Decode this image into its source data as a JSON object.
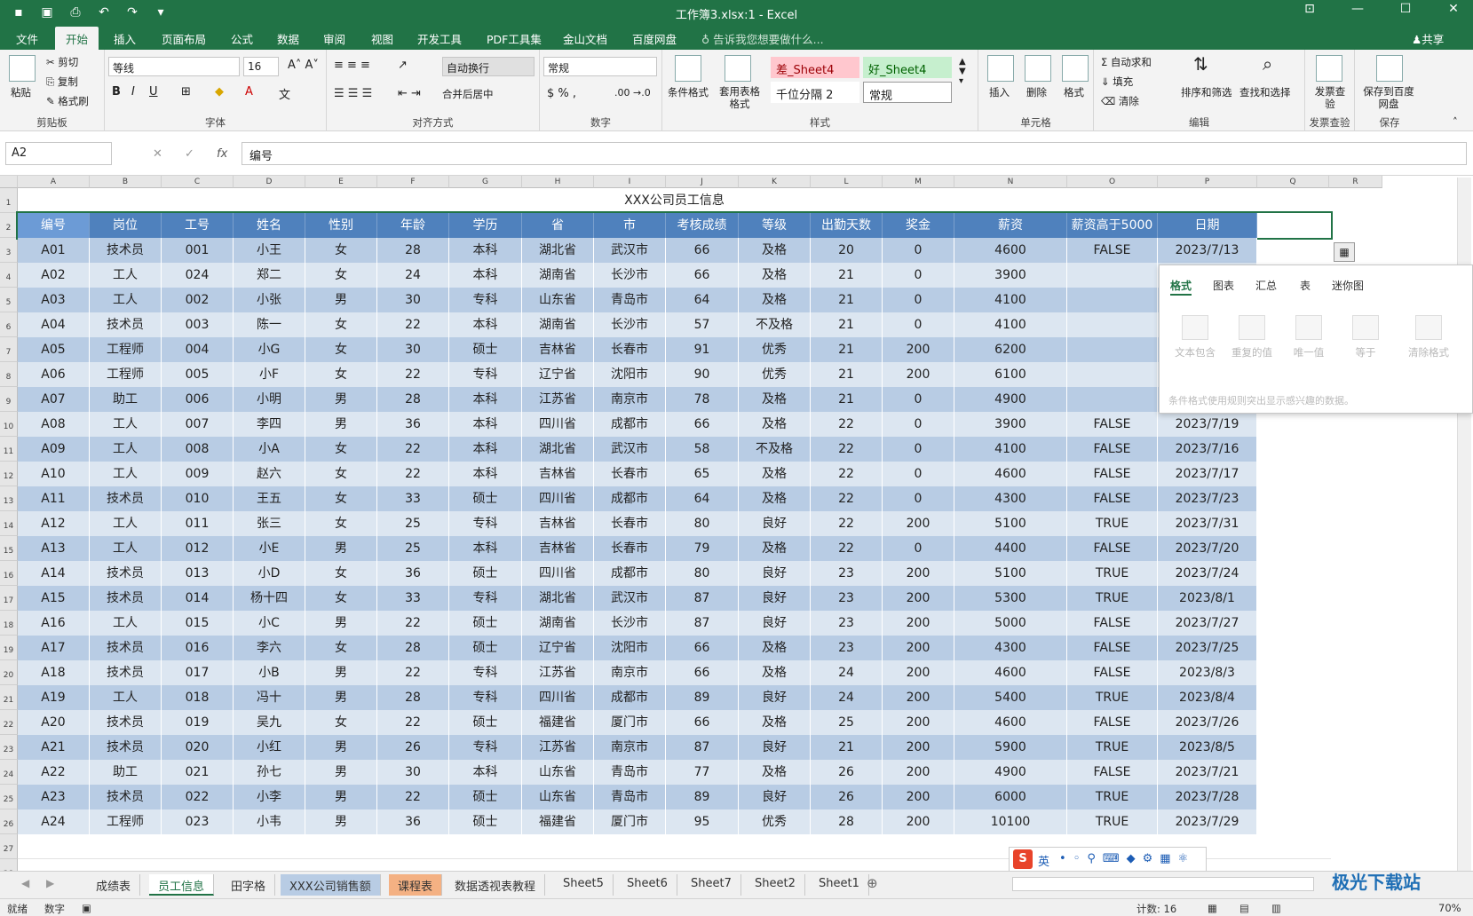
{
  "window": {
    "title": "工作簿3.xlsx:1 - Excel"
  },
  "qat": {
    "icons": [
      "save-icon",
      "save-as-pdf-icon",
      "print-preview-icon",
      "undo-icon",
      "redo-icon",
      "customize-icon"
    ]
  },
  "menu": {
    "items": [
      "文件",
      "开始",
      "插入",
      "页面布局",
      "公式",
      "数据",
      "审阅",
      "视图",
      "开发工具",
      "PDF工具集",
      "金山文档",
      "百度网盘"
    ],
    "tell_me": "告诉我您想要做什么...",
    "share": "共享"
  },
  "ribbon": {
    "clipboard": {
      "label": "剪贴板",
      "paste": "粘贴",
      "cut": "剪切",
      "copy": "复制",
      "format_painter": "格式刷"
    },
    "font": {
      "label": "字体",
      "name": "等线",
      "size": "16"
    },
    "align": {
      "label": "对齐方式",
      "wrap": "自动换行",
      "merge": "合并后居中"
    },
    "number": {
      "label": "数字",
      "format": "常规"
    },
    "styles": {
      "label": "样式",
      "cond_format": "条件格式",
      "table_format": "套用表格格式",
      "bad": "差_Sheet4",
      "good": "好_Sheet4",
      "comma": "千位分隔 2",
      "normal": "常规"
    },
    "cells": {
      "label": "单元格",
      "insert": "插入",
      "delete": "删除",
      "format": "格式"
    },
    "edit": {
      "label": "编辑",
      "autosum": "自动求和",
      "fill": "填充",
      "clear": "清除",
      "sort": "排序和筛选",
      "find": "查找和选择"
    },
    "invoice": {
      "label": "发票查验",
      "btn": "发票查验"
    },
    "save": {
      "label": "保存",
      "btn": "保存到百度网盘"
    }
  },
  "formula": {
    "namebox": "A2",
    "value": "编号"
  },
  "columns": [
    "A",
    "B",
    "C",
    "D",
    "E",
    "F",
    "G",
    "H",
    "I",
    "J",
    "K",
    "L",
    "M",
    "N",
    "O",
    "P",
    "Q",
    "R"
  ],
  "sheet": {
    "title": "XXX公司员工信息",
    "headers": [
      "编号",
      "岗位",
      "工号",
      "姓名",
      "性别",
      "年龄",
      "学历",
      "省",
      "市",
      "考核成绩",
      "等级",
      "出勤天数",
      "奖金",
      "薪资",
      "薪资高于5000",
      "日期"
    ],
    "rows": [
      [
        "A01",
        "技术员",
        "001",
        "小王",
        "女",
        "28",
        "本科",
        "湖北省",
        "武汉市",
        "66",
        "及格",
        "20",
        "0",
        "4600",
        "FALSE",
        "2023/7/13"
      ],
      [
        "A02",
        "工人",
        "024",
        "郑二",
        "女",
        "24",
        "本科",
        "湖南省",
        "长沙市",
        "66",
        "及格",
        "21",
        "0",
        "3900",
        "",
        ""
      ],
      [
        "A03",
        "工人",
        "002",
        "小张",
        "男",
        "30",
        "专科",
        "山东省",
        "青岛市",
        "64",
        "及格",
        "21",
        "0",
        "4100",
        "",
        ""
      ],
      [
        "A04",
        "技术员",
        "003",
        "陈一",
        "女",
        "22",
        "本科",
        "湖南省",
        "长沙市",
        "57",
        "不及格",
        "21",
        "0",
        "4100",
        "",
        ""
      ],
      [
        "A05",
        "工程师",
        "004",
        "小G",
        "女",
        "30",
        "硕士",
        "吉林省",
        "长春市",
        "91",
        "优秀",
        "21",
        "200",
        "6200",
        "",
        ""
      ],
      [
        "A06",
        "工程师",
        "005",
        "小F",
        "女",
        "22",
        "专科",
        "辽宁省",
        "沈阳市",
        "90",
        "优秀",
        "21",
        "200",
        "6100",
        "",
        ""
      ],
      [
        "A07",
        "助工",
        "006",
        "小明",
        "男",
        "28",
        "本科",
        "江苏省",
        "南京市",
        "78",
        "及格",
        "21",
        "0",
        "4900",
        "",
        ""
      ],
      [
        "A08",
        "工人",
        "007",
        "李四",
        "男",
        "36",
        "本科",
        "四川省",
        "成都市",
        "66",
        "及格",
        "22",
        "0",
        "3900",
        "FALSE",
        "2023/7/19"
      ],
      [
        "A09",
        "工人",
        "008",
        "小A",
        "女",
        "22",
        "本科",
        "湖北省",
        "武汉市",
        "58",
        "不及格",
        "22",
        "0",
        "4100",
        "FALSE",
        "2023/7/16"
      ],
      [
        "A10",
        "工人",
        "009",
        "赵六",
        "女",
        "22",
        "本科",
        "吉林省",
        "长春市",
        "65",
        "及格",
        "22",
        "0",
        "4600",
        "FALSE",
        "2023/7/17"
      ],
      [
        "A11",
        "技术员",
        "010",
        "王五",
        "女",
        "33",
        "硕士",
        "四川省",
        "成都市",
        "64",
        "及格",
        "22",
        "0",
        "4300",
        "FALSE",
        "2023/7/23"
      ],
      [
        "A12",
        "工人",
        "011",
        "张三",
        "女",
        "25",
        "专科",
        "吉林省",
        "长春市",
        "80",
        "良好",
        "22",
        "200",
        "5100",
        "TRUE",
        "2023/7/31"
      ],
      [
        "A13",
        "工人",
        "012",
        "小E",
        "男",
        "25",
        "本科",
        "吉林省",
        "长春市",
        "79",
        "及格",
        "22",
        "0",
        "4400",
        "FALSE",
        "2023/7/20"
      ],
      [
        "A14",
        "技术员",
        "013",
        "小D",
        "女",
        "36",
        "硕士",
        "四川省",
        "成都市",
        "80",
        "良好",
        "23",
        "200",
        "5100",
        "TRUE",
        "2023/7/24"
      ],
      [
        "A15",
        "技术员",
        "014",
        "杨十四",
        "女",
        "33",
        "专科",
        "湖北省",
        "武汉市",
        "87",
        "良好",
        "23",
        "200",
        "5300",
        "TRUE",
        "2023/8/1"
      ],
      [
        "A16",
        "工人",
        "015",
        "小C",
        "男",
        "22",
        "硕士",
        "湖南省",
        "长沙市",
        "87",
        "良好",
        "23",
        "200",
        "5000",
        "FALSE",
        "2023/7/27"
      ],
      [
        "A17",
        "技术员",
        "016",
        "李六",
        "女",
        "28",
        "硕士",
        "辽宁省",
        "沈阳市",
        "66",
        "及格",
        "23",
        "200",
        "4300",
        "FALSE",
        "2023/7/25"
      ],
      [
        "A18",
        "技术员",
        "017",
        "小B",
        "男",
        "22",
        "专科",
        "江苏省",
        "南京市",
        "66",
        "及格",
        "24",
        "200",
        "4600",
        "FALSE",
        "2023/8/3"
      ],
      [
        "A19",
        "工人",
        "018",
        "冯十",
        "男",
        "28",
        "专科",
        "四川省",
        "成都市",
        "89",
        "良好",
        "24",
        "200",
        "5400",
        "TRUE",
        "2023/8/4"
      ],
      [
        "A20",
        "技术员",
        "019",
        "吴九",
        "女",
        "22",
        "硕士",
        "福建省",
        "厦门市",
        "66",
        "及格",
        "25",
        "200",
        "4600",
        "FALSE",
        "2023/7/26"
      ],
      [
        "A21",
        "技术员",
        "020",
        "小红",
        "男",
        "26",
        "专科",
        "江苏省",
        "南京市",
        "87",
        "良好",
        "21",
        "200",
        "5900",
        "TRUE",
        "2023/8/5"
      ],
      [
        "A22",
        "助工",
        "021",
        "孙七",
        "男",
        "30",
        "本科",
        "山东省",
        "青岛市",
        "77",
        "及格",
        "26",
        "200",
        "4900",
        "FALSE",
        "2023/7/21"
      ],
      [
        "A23",
        "技术员",
        "022",
        "小李",
        "男",
        "22",
        "硕士",
        "山东省",
        "青岛市",
        "89",
        "良好",
        "26",
        "200",
        "6000",
        "TRUE",
        "2023/7/28"
      ],
      [
        "A24",
        "工程师",
        "023",
        "小韦",
        "男",
        "36",
        "硕士",
        "福建省",
        "厦门市",
        "95",
        "优秀",
        "28",
        "200",
        "10100",
        "TRUE",
        "2023/7/29"
      ]
    ]
  },
  "quick_analysis": {
    "tabs": [
      "格式",
      "图表",
      "汇总",
      "表",
      "迷你图"
    ],
    "items": [
      "文本包含",
      "重复的值",
      "唯一值",
      "等于",
      "清除格式"
    ],
    "desc": "条件格式使用规则突出显示感兴趣的数据。"
  },
  "sheet_tabs": [
    "成绩表",
    "员工信息",
    "田字格",
    "XXX公司销售额",
    "课程表",
    "数据透视表教程",
    "Sheet5",
    "Sheet6",
    "Sheet7",
    "Sheet2",
    "Sheet1"
  ],
  "status": {
    "ready": "就绪",
    "mode": "数字",
    "count": "计数: 16",
    "zoom": "70%"
  },
  "ime": {
    "lang": "英"
  },
  "watermark": "极光下载站"
}
